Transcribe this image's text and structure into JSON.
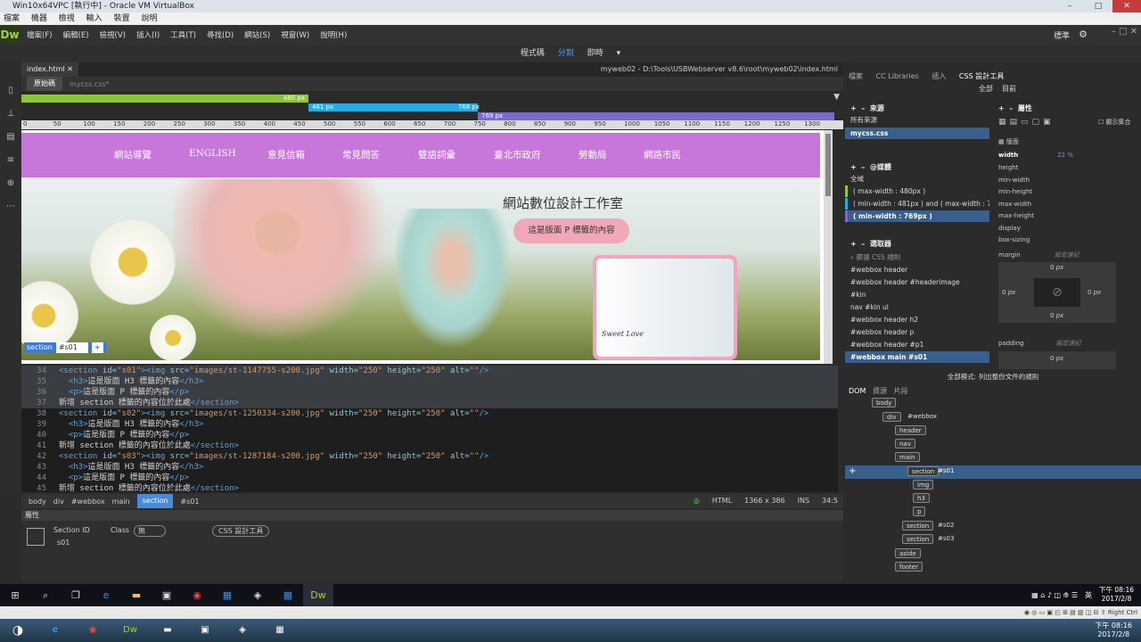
{
  "vbox": {
    "title": "Win10x64VPC [執行中] - Oracle VM VirtualBox",
    "menu": [
      "檔案",
      "機器",
      "檢視",
      "輸入",
      "裝置",
      "說明"
    ],
    "status": "Right Ctrl"
  },
  "dw": {
    "logo": "Dw",
    "menu": [
      "檔案(F)",
      "編輯(E)",
      "檢視(V)",
      "插入(I)",
      "工具(T)",
      "尋找(D)",
      "網站(S)",
      "視窗(W)",
      "說明(H)"
    ],
    "layout": "標準",
    "views": [
      "程式碼",
      "分割",
      "即時"
    ]
  },
  "doc": {
    "tab": "index.html",
    "path": "myweb02 - D:\\Tools\\USBWebserver v8.6\\root\\myweb02\\index.html",
    "src_on": "原始碼",
    "src_off": "mycss.css*"
  },
  "mq": [
    {
      "label": "480 px",
      "color": "#8cc63f"
    },
    {
      "label": "481 px",
      "color": "#29abe2"
    },
    {
      "label": "768 px",
      "color": "#29abe2"
    },
    {
      "label": "769 px",
      "color": "#7b6bc9"
    }
  ],
  "ruler": [
    "0",
    "50",
    "100",
    "150",
    "200",
    "250",
    "300",
    "350",
    "400",
    "450",
    "500",
    "550",
    "600",
    "650",
    "700",
    "750",
    "800",
    "850",
    "900",
    "950",
    "1000",
    "1050",
    "1100",
    "1150",
    "1200",
    "1250",
    "1300"
  ],
  "site": {
    "nav": [
      "網站導覽",
      "ENGLISH",
      "意見信箱",
      "常見問答",
      "雙語詞彙",
      "臺北市政府",
      "勞動局",
      "網路市民"
    ],
    "title": "網站數位設計工作室",
    "p": "這是版面 P 標籤的內容",
    "sweet": "Sweet Love",
    "section": "section",
    "section_id": "#s01"
  },
  "code": [
    {
      "n": "34",
      "sel": true,
      "t": [
        [
          "tag",
          "<section "
        ],
        [
          "at",
          "id="
        ],
        [
          "str",
          "\"s01\""
        ],
        [
          "tag",
          ">"
        ],
        [
          "tag",
          "<img "
        ],
        [
          "at",
          "src="
        ],
        [
          "str",
          "\"images/st-1147755-s200.jpg\""
        ],
        [
          "at",
          " width="
        ],
        [
          "str",
          "\"250\""
        ],
        [
          "at",
          " height="
        ],
        [
          "str",
          "\"250\""
        ],
        [
          "at",
          " alt="
        ],
        [
          "str",
          "\"\""
        ],
        [
          "tag",
          "/>"
        ]
      ]
    },
    {
      "n": "35",
      "sel": true,
      "t": [
        [
          "tag",
          "  <h3>"
        ],
        [
          "txt",
          "這是版面 H3 標籤的內容"
        ],
        [
          "tag",
          "</h3>"
        ]
      ]
    },
    {
      "n": "36",
      "sel": true,
      "t": [
        [
          "tag",
          "  <p>"
        ],
        [
          "txt",
          "這是版面 P 標籤的內容"
        ],
        [
          "tag",
          "</p>"
        ]
      ]
    },
    {
      "n": "37",
      "sel": true,
      "t": [
        [
          "txt",
          "新增 section 標籤的內容位於此處"
        ],
        [
          "tag",
          "</section>"
        ]
      ]
    },
    {
      "n": "38",
      "sel": false,
      "t": [
        [
          "tag",
          "<section "
        ],
        [
          "at",
          "id="
        ],
        [
          "str",
          "\"s02\""
        ],
        [
          "tag",
          ">"
        ],
        [
          "tag",
          "<img "
        ],
        [
          "at",
          "src="
        ],
        [
          "str",
          "\"images/st-1250334-s200.jpg\""
        ],
        [
          "at",
          " width="
        ],
        [
          "str",
          "\"250\""
        ],
        [
          "at",
          " height="
        ],
        [
          "str",
          "\"250\""
        ],
        [
          "at",
          " alt="
        ],
        [
          "str",
          "\"\""
        ],
        [
          "tag",
          "/>"
        ]
      ]
    },
    {
      "n": "39",
      "sel": false,
      "t": [
        [
          "tag",
          "  <h3>"
        ],
        [
          "txt",
          "這是版面 H3 標籤的內容"
        ],
        [
          "tag",
          "</h3>"
        ]
      ]
    },
    {
      "n": "40",
      "sel": false,
      "t": [
        [
          "tag",
          "  <p>"
        ],
        [
          "txt",
          "這是版面 P 標籤的內容"
        ],
        [
          "tag",
          "</p>"
        ]
      ]
    },
    {
      "n": "41",
      "sel": false,
      "t": [
        [
          "txt",
          "新增 section 標籤的內容位於此處"
        ],
        [
          "tag",
          "</section>"
        ]
      ]
    },
    {
      "n": "42",
      "sel": false,
      "t": [
        [
          "tag",
          "<section "
        ],
        [
          "at",
          "id="
        ],
        [
          "str",
          "\"s03\""
        ],
        [
          "tag",
          ">"
        ],
        [
          "tag",
          "<img "
        ],
        [
          "at",
          "src="
        ],
        [
          "str",
          "\"images/st-1287184-s200.jpg\""
        ],
        [
          "at",
          " width="
        ],
        [
          "str",
          "\"250\""
        ],
        [
          "at",
          " height="
        ],
        [
          "str",
          "\"250\""
        ],
        [
          "at",
          " alt="
        ],
        [
          "str",
          "\"\""
        ],
        [
          "tag",
          "/>"
        ]
      ]
    },
    {
      "n": "43",
      "sel": false,
      "t": [
        [
          "tag",
          "  <h3>"
        ],
        [
          "txt",
          "這是版面 H3 標籤的內容"
        ],
        [
          "tag",
          "</h3>"
        ]
      ]
    },
    {
      "n": "44",
      "sel": false,
      "t": [
        [
          "tag",
          "  <p>"
        ],
        [
          "txt",
          "這是版面 P 標籤的內容"
        ],
        [
          "tag",
          "</p>"
        ]
      ]
    },
    {
      "n": "45",
      "sel": false,
      "t": [
        [
          "txt",
          "新增 section 標籤的內容位於此處"
        ],
        [
          "tag",
          "</section>"
        ]
      ]
    }
  ],
  "status": {
    "crumbs": [
      "body",
      "div",
      "#webbox",
      "main",
      "section",
      "#s01"
    ],
    "lang": "HTML",
    "size": "1366 x 386",
    "ins": "INS",
    "pos": "34:5"
  },
  "props": {
    "title": "屬性",
    "section_id_label": "Section ID",
    "section_id": "s01",
    "class_label": "Class",
    "class_val": "無",
    "css_btn": "CSS 設計工具"
  },
  "right": {
    "tabs": [
      "檔案",
      "CC Libraries",
      "插入",
      "CSS 設計工具"
    ],
    "sub": [
      "全部",
      "目前"
    ],
    "sources": "來源",
    "all_sources": "所有來源",
    "css_file": "mycss.css",
    "media": "@媒體",
    "global": "全域",
    "mq1": "( max-width : 480px )",
    "mq2": "( min-width : 481px ) and ( max-width : 76...",
    "mq3": "( min-width : 769px )",
    "selectors": "選取器",
    "filter": "篩選 CSS 規則",
    "sel_list": [
      "#webbox header",
      "#webbox header #headerimage",
      "#kin",
      "nav #kin ul",
      "#webbox header h2",
      "#webbox header p",
      "#webbox header #p1",
      "#webbox main #s01"
    ],
    "props_title": "屬性",
    "show_set": "顯示集合",
    "layout": "版面",
    "width_label": "width",
    "width_val": "22 %",
    "p_names": [
      "height",
      "min-width",
      "min-height",
      "max-width",
      "max-height",
      "display",
      "box-sizing"
    ],
    "margin": "margin",
    "padding": "padding",
    "set_short": "設定速記",
    "zero": "0",
    "px": "px",
    "all_mode": "全部模式: 列出整份文件的規則"
  },
  "dom": {
    "tabs": [
      "DOM",
      "資源",
      "片段"
    ],
    "nodes": [
      "body",
      "div",
      "header",
      "nav",
      "main",
      "section",
      "img",
      "h3",
      "p",
      "section",
      "section",
      "aside",
      "footer"
    ],
    "webbox": "#webbox",
    "s01": "#s01",
    "s02": "#s02",
    "s03": "#s03"
  },
  "taskbar": {
    "ime": "英",
    "time": "下午 08:16",
    "date": "2017/2/8"
  }
}
